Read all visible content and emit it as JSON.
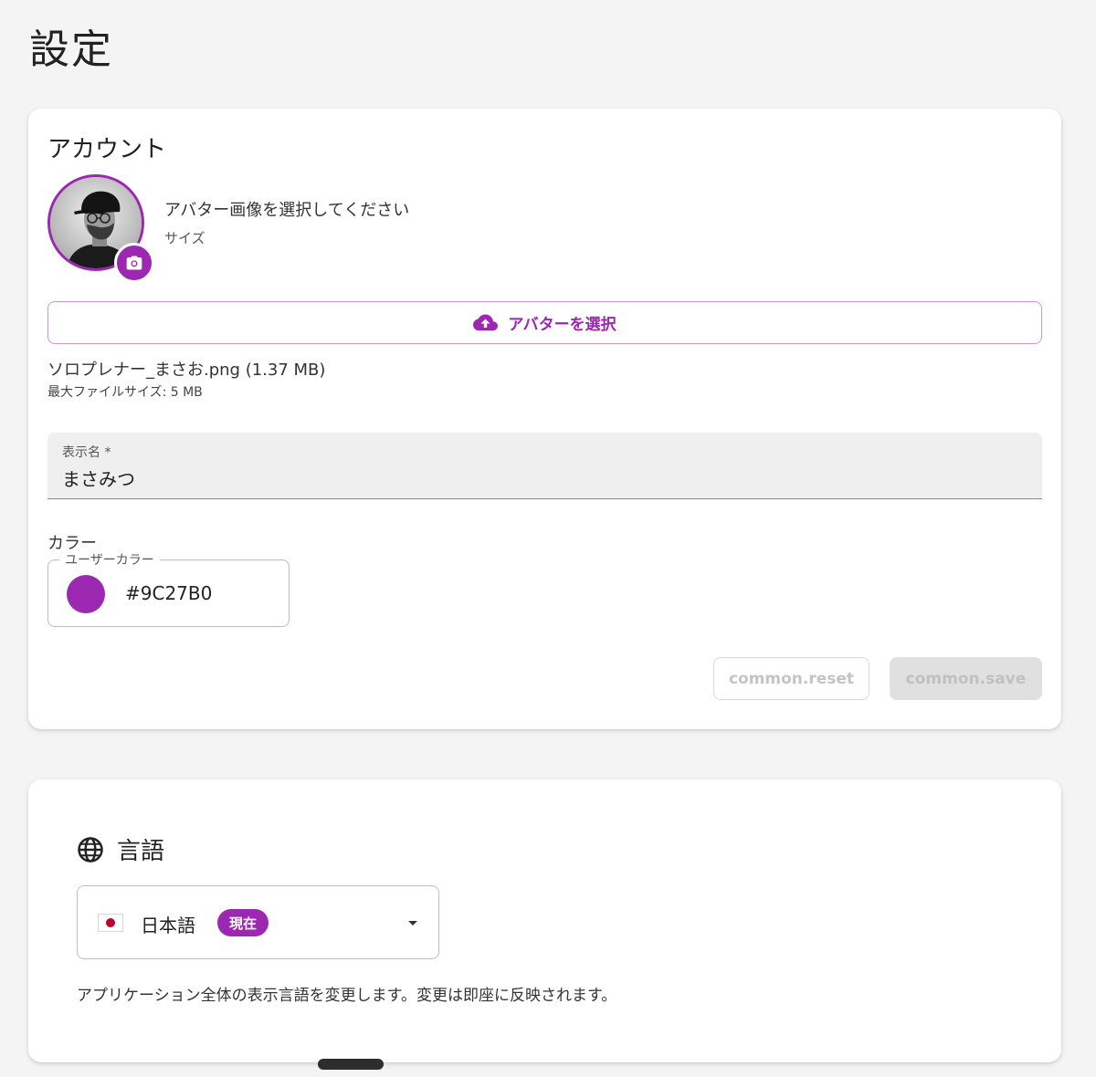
{
  "page": {
    "title": "設定"
  },
  "account": {
    "section_title": "アカウント",
    "avatar_prompt": "アバター画像を選択してください",
    "avatar_size_label": "サイズ",
    "select_avatar_label": "アバターを選択",
    "file_name": "ソロプレナー_まさお.png (1.37 MB)",
    "max_file_size": "最大ファイルサイズ: 5 MB",
    "display_name": {
      "label": "表示名 *",
      "value": "まさみつ"
    },
    "color": {
      "heading": "カラー",
      "field_label": "ユーザーカラー",
      "value": "#9C27B0",
      "swatch_color": "#9C27B0"
    },
    "reset_label": "common.reset",
    "save_label": "common.save"
  },
  "language": {
    "section_title": "言語",
    "selected": "日本語",
    "current_badge": "現在",
    "description": "アプリケーション全体の表示言語を変更します。変更は即座に反映されます。"
  },
  "colors": {
    "accent": "#9C27B0",
    "background": "#F4F4F4",
    "flag_red": "#BC002D"
  },
  "icons": {
    "camera": "camera-icon",
    "upload": "cloud-upload-icon",
    "globe": "globe-icon",
    "dropdown": "caret-down-icon"
  }
}
